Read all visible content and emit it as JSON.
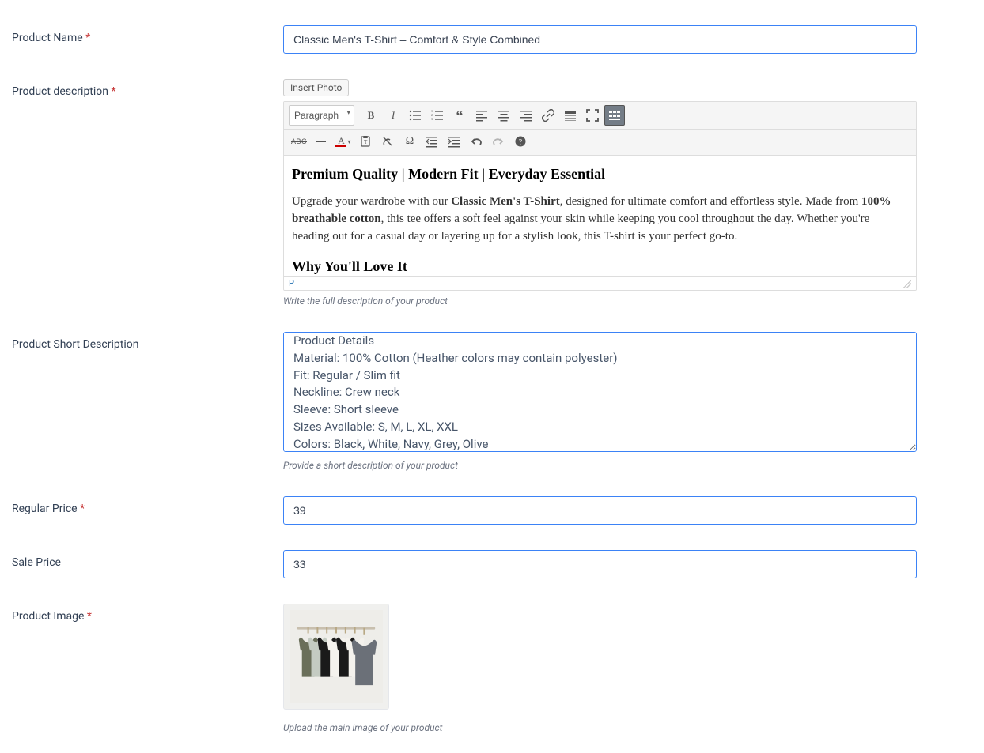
{
  "labels": {
    "productName": "Product Name",
    "productDescription": "Product description",
    "productShortDescription": "Product Short Description",
    "regularPrice": "Regular Price",
    "salePrice": "Sale Price",
    "productImage": "Product Image",
    "asterisk": "*"
  },
  "values": {
    "productName": "Classic Men's T-Shirt – Comfort & Style Combined",
    "regularPrice": "39",
    "salePrice": "33",
    "shortDescription": "Product Details\nMaterial: 100% Cotton (Heather colors may contain polyester)\nFit: Regular / Slim fit\nNeckline: Crew neck\nSleeve: Short sleeve\nSizes Available: S, M, L, XL, XXL\nColors: Black, White, Navy, Grey, Olive"
  },
  "editor": {
    "insertPhoto": "Insert Photo",
    "formatSelect": "Paragraph",
    "statusPath": "P",
    "content": {
      "h3_1": "Premium Quality | Modern Fit | Everyday Essential",
      "p_pre": "Upgrade your wardrobe with our ",
      "b1": "Classic Men's T-Shirt",
      "p_mid": ", designed for ultimate comfort and effortless style. Made from ",
      "b2": "100% breathable cotton",
      "p_post": ", this tee offers a soft feel against your skin while keeping you cool throughout the day. Whether you're heading out for a casual day or layering up for a stylish look, this T-shirt is your perfect go-to.",
      "h3_2": "Why You'll Love It"
    }
  },
  "help": {
    "description": "Write the full description of your product",
    "shortDescription": "Provide a short description of your product",
    "productImage": "Upload the main image of your product"
  }
}
